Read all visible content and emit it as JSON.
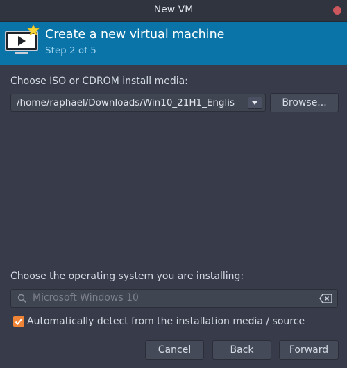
{
  "window": {
    "title": "New VM"
  },
  "banner": {
    "title": "Create a new virtual machine",
    "subtitle": "Step 2 of 5"
  },
  "media": {
    "label": "Choose ISO or CDROM install media:",
    "path": "/home/raphael/Downloads/Win10_21H1_Englis",
    "browse_label": "Browse..."
  },
  "os": {
    "label": "Choose the operating system you are installing:",
    "placeholder": "Microsoft Windows 10",
    "autodetect_label": "Automatically detect from the installation media / source",
    "autodetect_checked": true
  },
  "footer": {
    "cancel_label": "Cancel",
    "back_label": "Back",
    "forward_label": "Forward"
  },
  "colors": {
    "window_bg": "#383c4a",
    "banner_bg": "#0a74a8",
    "checkbox_accent": "#f08437",
    "close_button": "#cc575d"
  },
  "icons": {
    "banner": "vm-screen-with-star-icon",
    "dropdown": "chevron-down-icon",
    "search": "search-icon",
    "clear": "backspace-clear-icon",
    "check": "checkmark-icon",
    "close": "close-dot-icon"
  }
}
